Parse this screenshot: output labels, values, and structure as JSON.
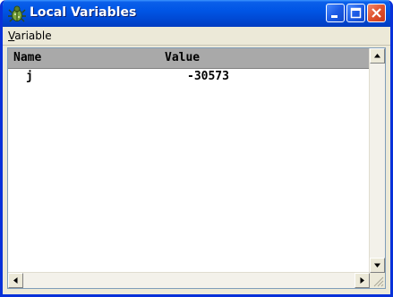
{
  "window": {
    "title": "Local Variables",
    "app_icon": "bug-icon",
    "controls": [
      "minimize-icon",
      "maximize-icon",
      "close-icon"
    ]
  },
  "menu": {
    "items": [
      {
        "accel": "V",
        "rest": "ariable"
      }
    ]
  },
  "table": {
    "columns": [
      "Name",
      "Value"
    ],
    "rows": [
      {
        "name": "j",
        "value": "-30573"
      }
    ]
  },
  "colors": {
    "titlebar": "#0055e5",
    "close_button": "#e0522d",
    "header_bg": "#a9a9a9"
  }
}
